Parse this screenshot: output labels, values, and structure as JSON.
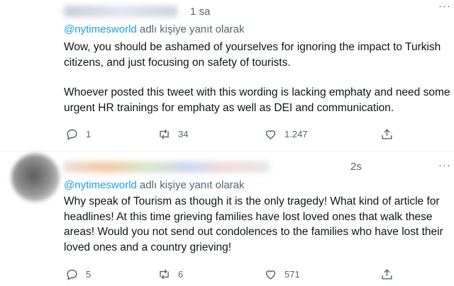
{
  "tweets": [
    {
      "time": "1 sa",
      "more": "···",
      "reply_handle": "@nytimesworld",
      "reply_suffix": " adlı kişiye yanıt olarak",
      "paragraphs": [
        "Wow, you should be ashamed of yourselves for ignoring the impact to Turkish citizens, and just focusing on safety of tourists.",
        "Whoever posted this tweet with this wording is lacking emphaty and need some urgent HR trainings for emphaty as well as DEI and communication."
      ],
      "replies": "1",
      "retweets": "34",
      "likes": "1.247"
    },
    {
      "time": "2s",
      "more": "···",
      "reply_handle": "@nytimesworld",
      "reply_suffix": " adlı kişiye yanıt olarak",
      "paragraphs": [
        "Why speak of Tourism as though it is the only tragedy! What kind of article for headlines! At this time grieving families have lost loved ones that walk these areas! Would you not send out condolences to the families who have lost their loved ones and a country grieving!"
      ],
      "replies": "5",
      "retweets": "6",
      "likes": "571"
    }
  ],
  "icons": {
    "reply": "reply-icon",
    "retweet": "retweet-icon",
    "like": "heart-icon",
    "share": "share-icon"
  },
  "colors": {
    "link": "#1d9bf0",
    "secondary": "#536471",
    "text": "#0f1419",
    "divider": "#eff3f4"
  }
}
